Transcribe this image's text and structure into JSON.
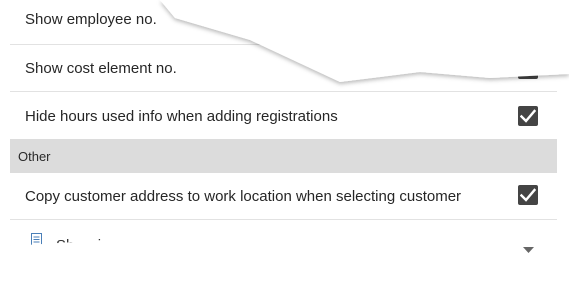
{
  "settings": {
    "rows": [
      {
        "label": "Show employee no.",
        "checked": null
      },
      {
        "label": "Show cost element no.",
        "checked": true
      },
      {
        "label": "Hide hours used info when adding registrations",
        "checked": true
      }
    ],
    "section": {
      "label": "Other"
    },
    "other_rows": [
      {
        "label": "Copy customer address to work location when selecting customer",
        "checked": true
      }
    ],
    "select": {
      "label": "Show in order",
      "icon": "document-icon"
    }
  },
  "colors": {
    "checkbox": "#444444",
    "section_bg": "#dcdcdc",
    "divider": "#e2e2e2"
  }
}
